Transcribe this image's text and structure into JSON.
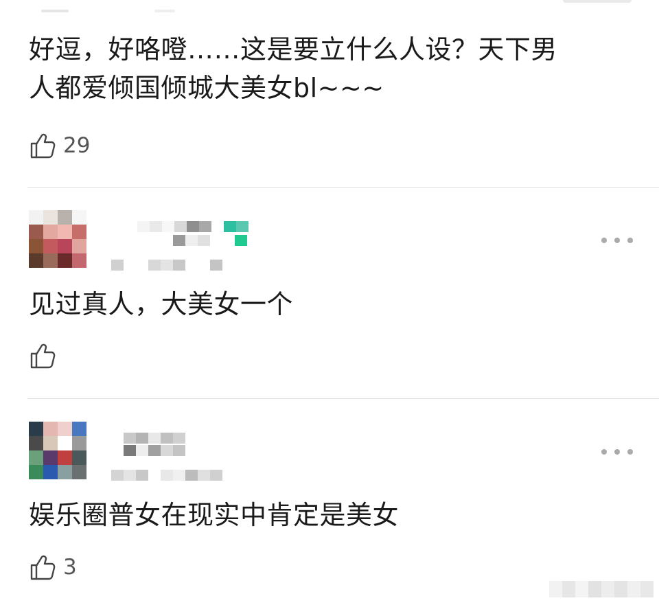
{
  "comments": [
    {
      "text_line1": "好逗，好咯噔……这是要立什么人设？天下男",
      "text_line2": "人都爱倾国倾城大美女bl~~~",
      "likes": "29",
      "like_icon": "thumbs-up-icon"
    },
    {
      "text": "见过真人，大美女一个",
      "likes": "",
      "like_icon": "thumbs-up-icon",
      "more_icon": "more-icon"
    },
    {
      "text": "娱乐圈普女在现实中肯定是美女",
      "likes": "3",
      "like_icon": "thumbs-up-icon",
      "more_icon": "more-icon"
    }
  ],
  "colors": {
    "text": "#1a1a1a",
    "like_count": "#555555",
    "divider": "#dedede",
    "more_dots": "#aaaaaa",
    "username_accent": "#2dbf9f"
  }
}
